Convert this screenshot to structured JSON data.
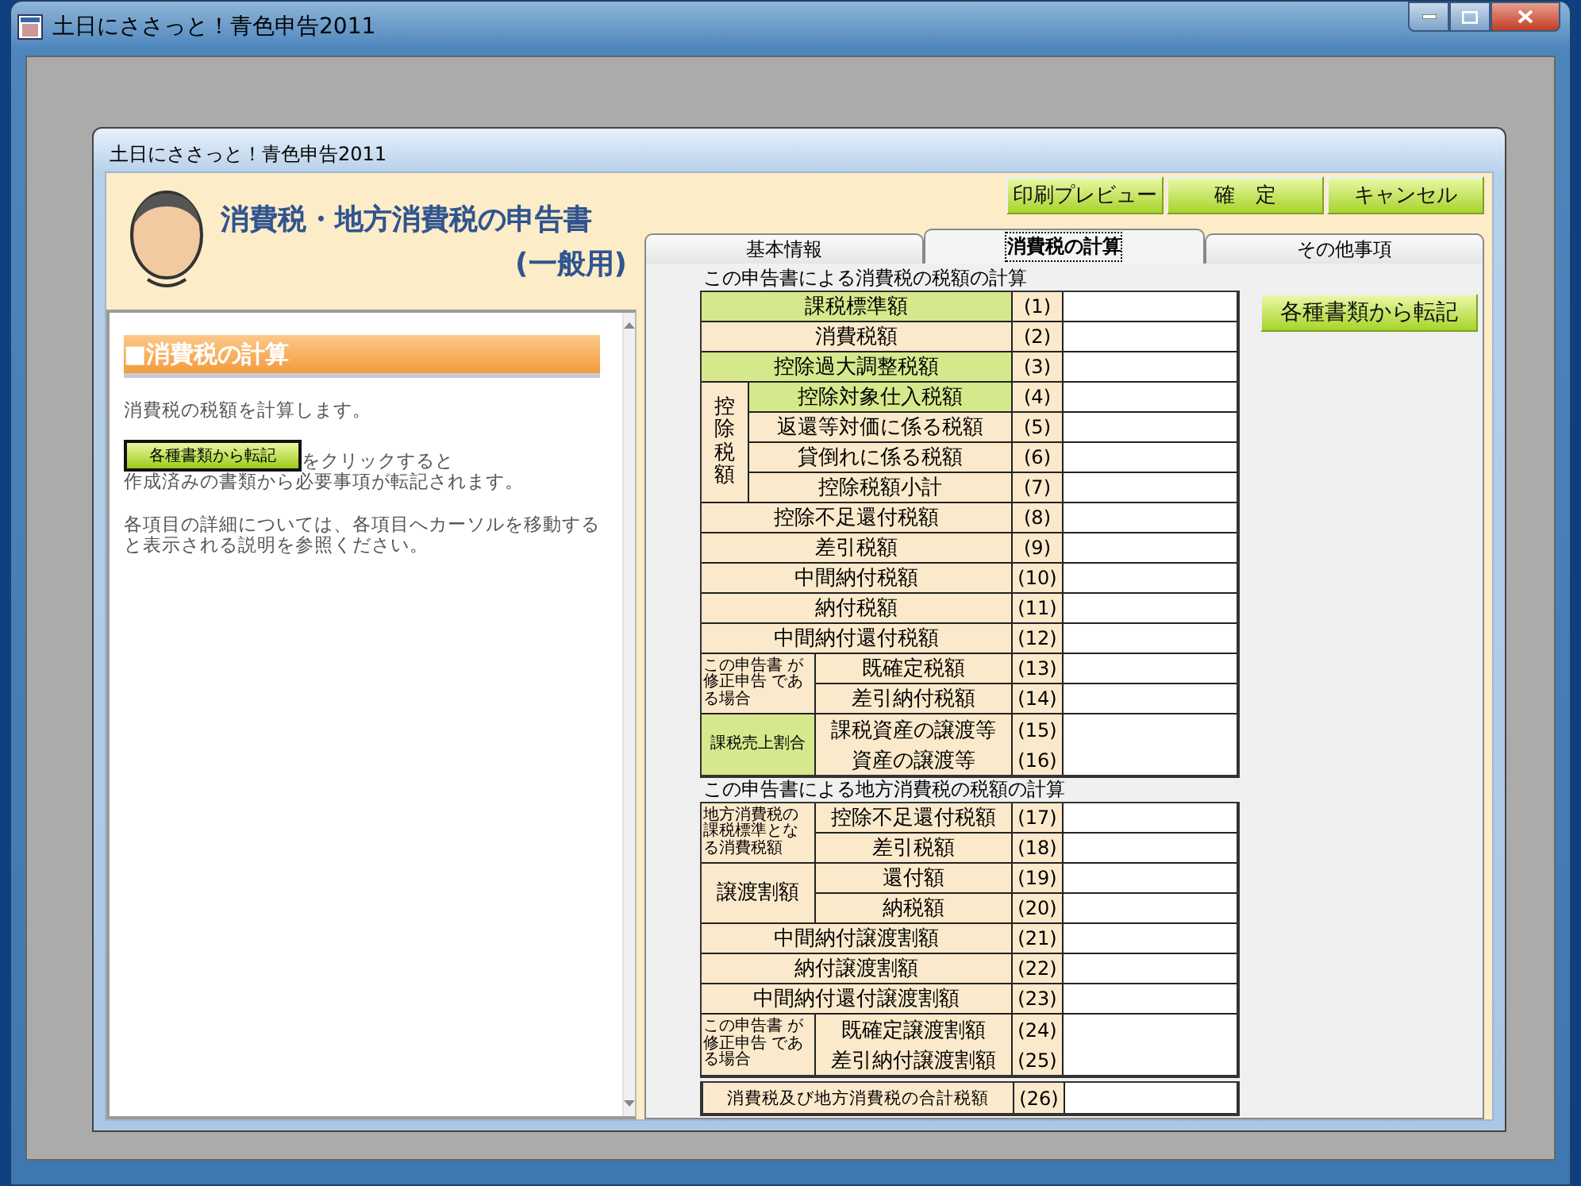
{
  "window": {
    "title": "土日にささっと！青色申告2011"
  },
  "dialog": {
    "title": "土日にささっと！青色申告2011"
  },
  "header": {
    "title": "消費税・地方消費税の申告書",
    "subtitle": "(一般用)"
  },
  "toolbar": {
    "buttons": [
      "印刷プレビュー",
      "確　定",
      "キャンセル"
    ]
  },
  "help": {
    "heading": "■消費税の計算",
    "intro": "消費税の税額を計算します。",
    "inline_button": "各種書類から転記",
    "after_button": "をクリックすると",
    "result": "作成済みの書類から必要事項が転記されます。",
    "detail": "各項目の詳細については、各項目へカーソルを移動すると表示される説明を参照ください。"
  },
  "tabs": [
    {
      "label": "基本情報",
      "selected": false
    },
    {
      "label": "消費税の計算",
      "selected": true
    },
    {
      "label": "その他事項",
      "selected": false
    }
  ],
  "transfer_button": "各種書類から転記",
  "sections": [
    {
      "title": "この申告書による消費税の税額の計算",
      "blocks": [
        {
          "kind": "single",
          "label": "課税標準額",
          "number": "(1)",
          "highlighted": true
        },
        {
          "kind": "single",
          "label": "消費税額",
          "number": "(2)",
          "highlighted": false
        },
        {
          "kind": "single",
          "label": "控除過大調整税額",
          "number": "(3)",
          "highlighted": true
        },
        {
          "kind": "vgroup",
          "label": "控除税額",
          "highlighted": false,
          "small_label": false,
          "rows": [
            {
              "label": "控除対象仕入税額",
              "number": "(4)",
              "highlighted": true
            },
            {
              "label": "返還等対価に係る税額",
              "number": "(5)",
              "highlighted": false
            },
            {
              "label": "貸倒れに係る税額",
              "number": "(6)",
              "highlighted": false
            },
            {
              "label": "控除税額小計",
              "number": "(7)",
              "highlighted": false
            }
          ]
        },
        {
          "kind": "single",
          "label": "控除不足還付税額",
          "number": "(8)",
          "highlighted": false
        },
        {
          "kind": "single",
          "label": "差引税額",
          "number": "(9)",
          "highlighted": false
        },
        {
          "kind": "single",
          "label": "中間納付税額",
          "number": "(10)",
          "highlighted": false
        },
        {
          "kind": "single",
          "label": "納付税額",
          "number": "(11)",
          "highlighted": false
        },
        {
          "kind": "single",
          "label": "中間納付還付税額",
          "number": "(12)",
          "highlighted": false
        },
        {
          "kind": "group",
          "label": "この申告書 が修正申告 である場合",
          "highlighted": false,
          "small_label": true,
          "rows": [
            {
              "label": "既確定税額",
              "number": "(13)",
              "highlighted": false
            },
            {
              "label": "差引納付税額",
              "number": "(14)",
              "highlighted": false
            }
          ]
        },
        {
          "kind": "group",
          "label": "課税売上割合",
          "highlighted": true,
          "small_label": true,
          "rows": [
            {
              "label": "課税資産の譲渡等",
              "number": "(15)",
              "highlighted": false
            },
            {
              "label": "資産の譲渡等",
              "number": "(16)",
              "highlighted": false
            }
          ]
        }
      ]
    },
    {
      "title": "この申告書による地方消費税の税額の計算",
      "blocks": [
        {
          "kind": "group",
          "label": "地方消費税の課税標準となる消費税額",
          "highlighted": false,
          "small_label": true,
          "rows": [
            {
              "label": "控除不足還付税額",
              "number": "(17)",
              "highlighted": false
            },
            {
              "label": "差引税額",
              "number": "(18)",
              "highlighted": false
            }
          ]
        },
        {
          "kind": "group",
          "label": "譲渡割額",
          "highlighted": false,
          "small_label": false,
          "rows": [
            {
              "label": "還付額",
              "number": "(19)",
              "highlighted": false
            },
            {
              "label": "納税額",
              "number": "(20)",
              "highlighted": false
            }
          ]
        },
        {
          "kind": "single",
          "label": "中間納付譲渡割額",
          "number": "(21)",
          "highlighted": false
        },
        {
          "kind": "single",
          "label": "納付譲渡割額",
          "number": "(22)",
          "highlighted": false
        },
        {
          "kind": "single",
          "label": "中間納付還付譲渡割額",
          "number": "(23)",
          "highlighted": false
        },
        {
          "kind": "group",
          "label": "この申告書 が修正申告 である場合",
          "highlighted": false,
          "small_label": true,
          "rows": [
            {
              "label": "既確定譲渡割額",
              "number": "(24)",
              "highlighted": false
            },
            {
              "label": "差引納付譲渡割額",
              "number": "(25)",
              "highlighted": false
            }
          ]
        }
      ]
    },
    {
      "blocks": [
        {
          "kind": "total",
          "label": "消費税及び地方消費税の合計税額",
          "number": "(26)",
          "highlighted": false
        }
      ]
    }
  ]
}
